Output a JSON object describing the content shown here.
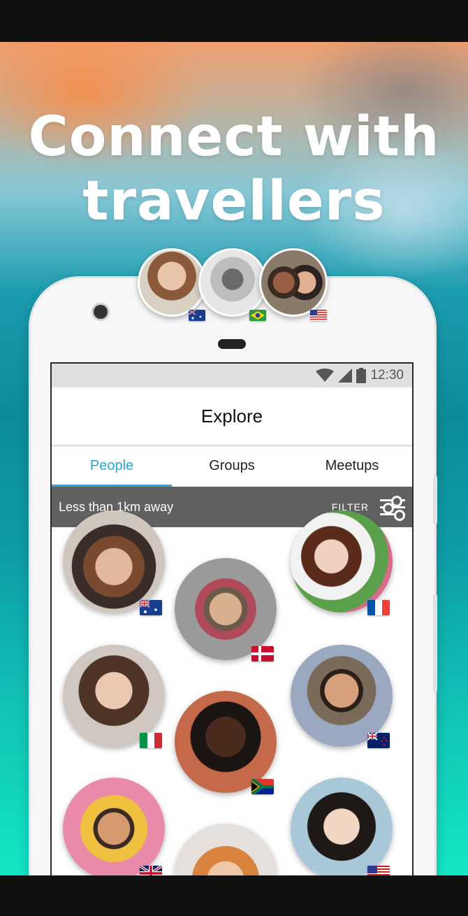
{
  "headline": {
    "line1": "Connect with",
    "line2": "travellers"
  },
  "status_bar": {
    "time": "12:30",
    "icons": [
      "wifi-icon",
      "signal-icon",
      "battery-icon"
    ]
  },
  "app_bar": {
    "title": "Explore"
  },
  "tabs": [
    {
      "label": "People",
      "active": true
    },
    {
      "label": "Groups",
      "active": false
    },
    {
      "label": "Meetups",
      "active": false
    }
  ],
  "filter_bar": {
    "distance_text": "Less than 1km away",
    "filter_label": "FILTER"
  },
  "top_avatars": [
    {
      "flag": "australia"
    },
    {
      "flag": "brazil"
    },
    {
      "flag": "usa"
    }
  ],
  "people": [
    {
      "flag": "australia"
    },
    {
      "flag": "denmark"
    },
    {
      "flag": "france"
    },
    {
      "flag": "italy"
    },
    {
      "flag": "south-africa"
    },
    {
      "flag": "new-zealand"
    },
    {
      "flag": "uk"
    },
    {
      "flag": "unknown"
    },
    {
      "flag": "usa"
    }
  ],
  "colors": {
    "accent": "#2aa6d9",
    "filter_bar": "#616161",
    "status_bar": "#e0e0e0"
  }
}
